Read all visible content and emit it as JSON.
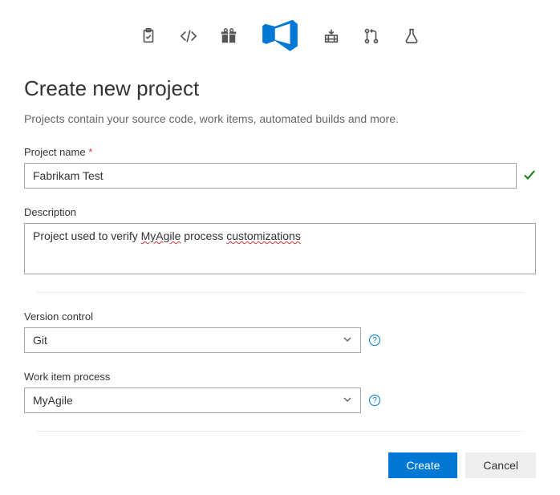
{
  "header": {
    "title": "Create new project",
    "subtitle": "Projects contain your source code, work items, automated builds and more."
  },
  "icons": {
    "work": "clipboard-check-icon",
    "code": "code-icon",
    "gift": "gift-icon",
    "devops": "azure-devops-icon",
    "build": "build-icon",
    "branch": "pull-request-icon",
    "test": "test-flask-icon"
  },
  "fields": {
    "project_name": {
      "label": "Project name",
      "required_marker": "*",
      "value": "Fabrikam Test",
      "valid": true
    },
    "description": {
      "label": "Description",
      "value_parts": {
        "p1": "Project used to verify ",
        "err1": "MyAgile",
        "p2": " process ",
        "err2": "customizations"
      }
    },
    "version_control": {
      "label": "Version control",
      "value": "Git",
      "help": "?"
    },
    "work_item_process": {
      "label": "Work item process",
      "value": "MyAgile",
      "help": "?"
    }
  },
  "buttons": {
    "create": "Create",
    "cancel": "Cancel"
  }
}
